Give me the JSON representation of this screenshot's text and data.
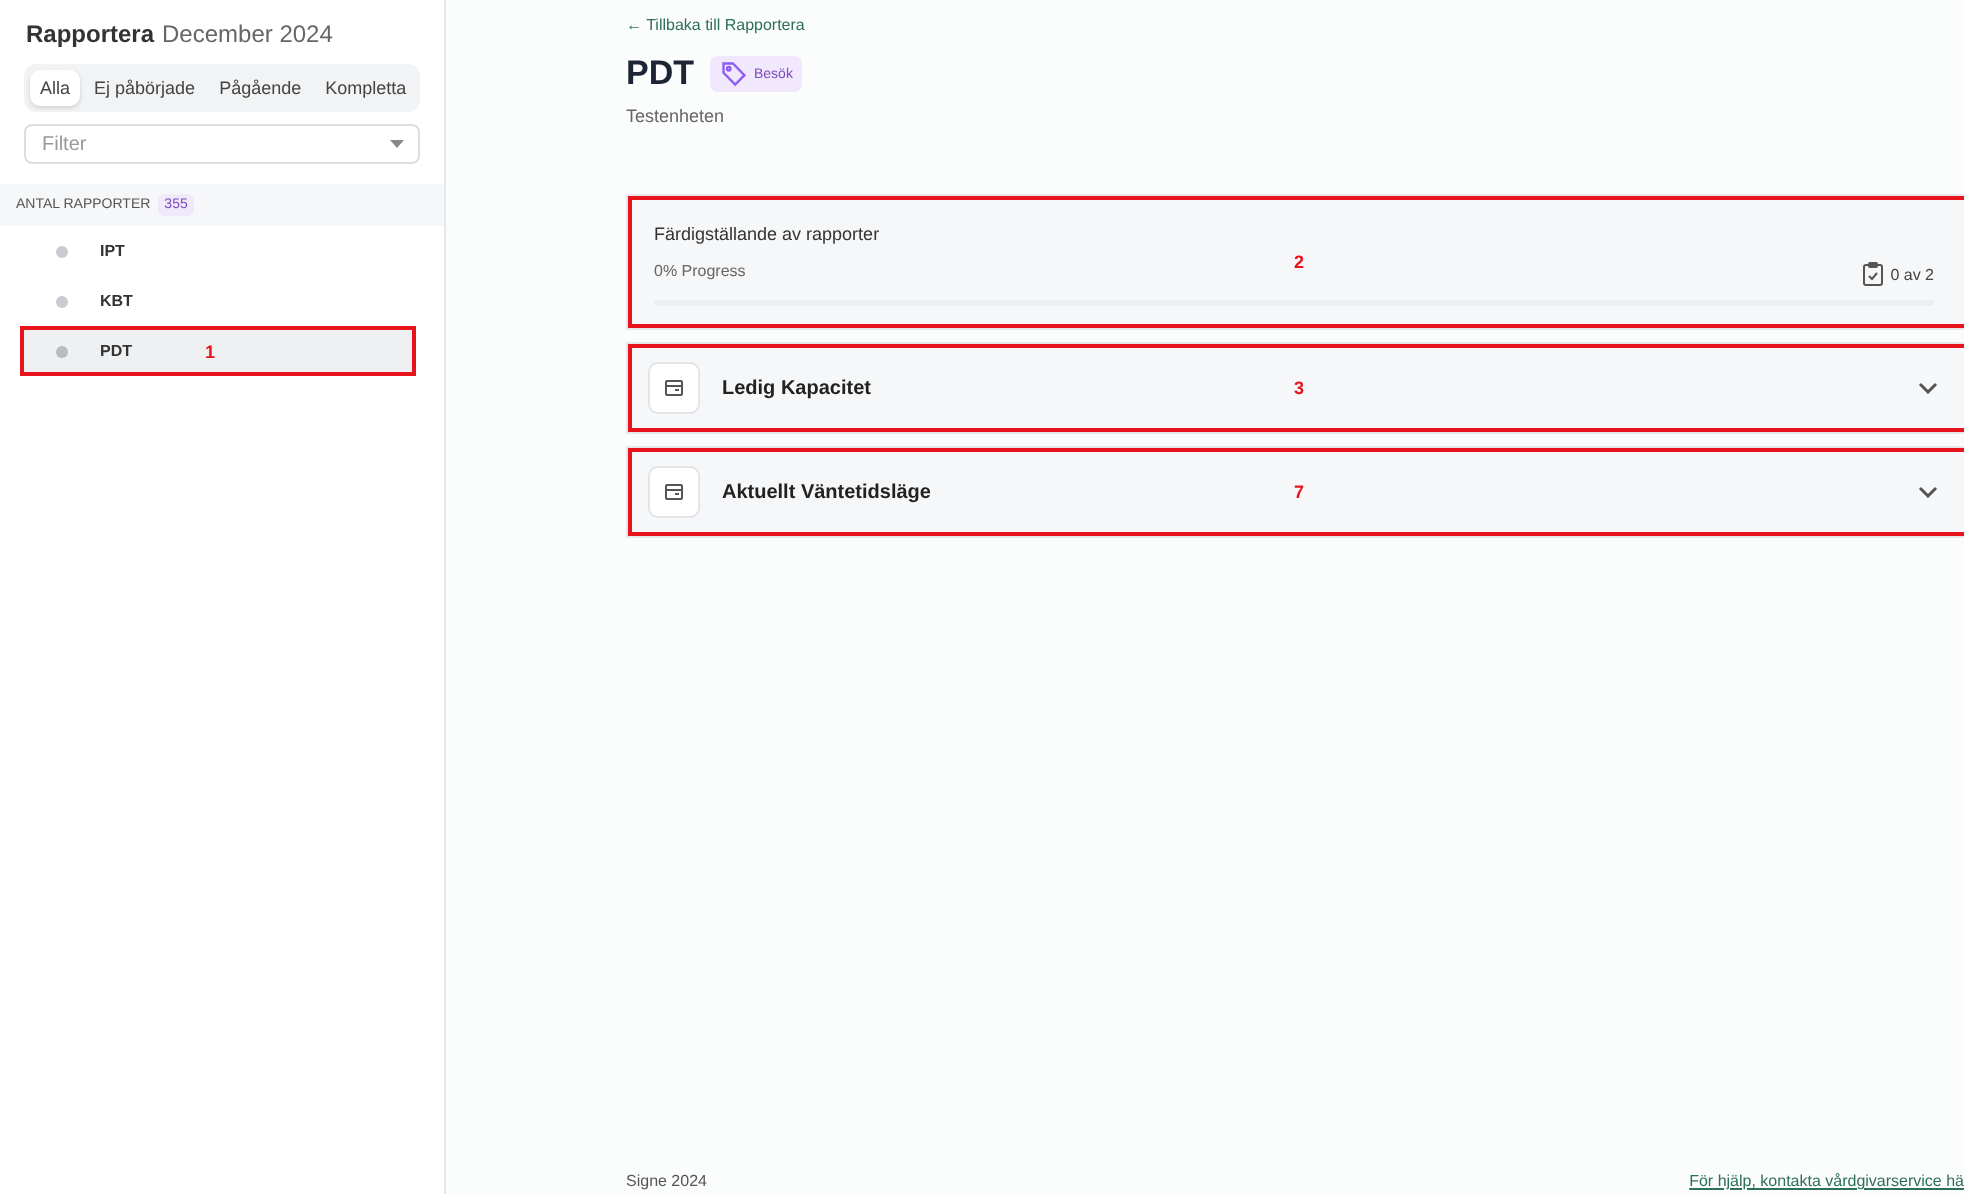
{
  "sidebar": {
    "title": "Rapportera",
    "period": "December 2024",
    "tabs": [
      {
        "label": "Alla",
        "selected": true
      },
      {
        "label": "Ej påbörjade",
        "selected": false
      },
      {
        "label": "Pågående",
        "selected": false
      },
      {
        "label": "Kompletta",
        "selected": false
      }
    ],
    "filter": {
      "placeholder": "Filter"
    },
    "count_label": "ANTAL RAPPORTER",
    "count": "355",
    "items": [
      {
        "label": "IPT",
        "selected": false
      },
      {
        "label": "KBT",
        "selected": false
      },
      {
        "label": "PDT",
        "selected": true,
        "annotation": "1"
      }
    ]
  },
  "main": {
    "back_link": "← Tillbaka till Rapportera",
    "title": "PDT",
    "tag": "Besök",
    "subtitle": "Testenheten",
    "progress": {
      "title": "Färdigställande av rapporter",
      "reading": "0% Progress",
      "level": 0,
      "count": "0 av 2",
      "annotation": "2"
    },
    "sections": [
      {
        "title": "Ledig Kapacitet",
        "expanded": false,
        "annotation": "3"
      },
      {
        "title": "Aktuellt Väntetidsläge",
        "expanded": false,
        "annotation": "7"
      }
    ]
  },
  "footer": {
    "left": "Signe 2024",
    "right": "För hjälp, kontakta vårdgivarservice hä"
  }
}
